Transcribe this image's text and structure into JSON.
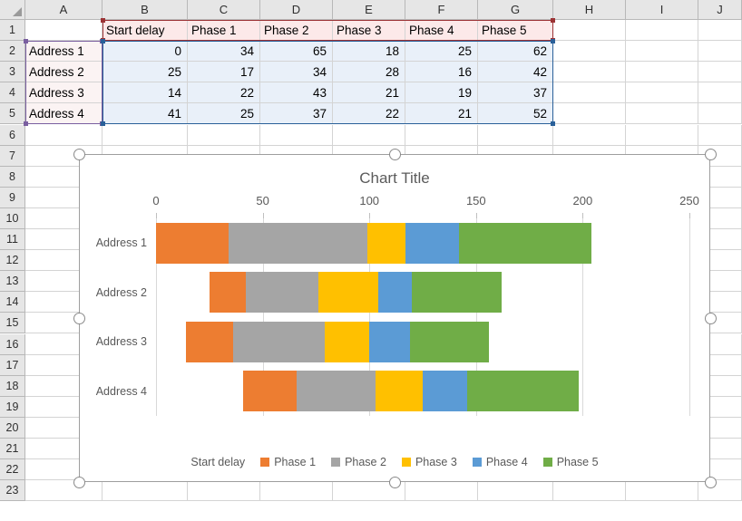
{
  "spreadsheet": {
    "columns": [
      "A",
      "B",
      "C",
      "D",
      "E",
      "F",
      "G",
      "H",
      "I",
      "J"
    ],
    "rows": [
      "1",
      "2",
      "3",
      "4",
      "5",
      "6",
      "7",
      "8",
      "9",
      "10",
      "11",
      "12",
      "13",
      "14",
      "15",
      "16",
      "17",
      "18",
      "19",
      "20",
      "21",
      "22",
      "23"
    ],
    "header_row": [
      "",
      "Start delay",
      "Phase 1",
      "Phase 2",
      "Phase 3",
      "Phase 4",
      "Phase 5"
    ],
    "data_rows": [
      {
        "label": "Address 1",
        "values": [
          "0",
          "34",
          "65",
          "18",
          "25",
          "62"
        ]
      },
      {
        "label": "Address 2",
        "values": [
          "25",
          "17",
          "34",
          "28",
          "16",
          "42"
        ]
      },
      {
        "label": "Address 3",
        "values": [
          "14",
          "22",
          "43",
          "21",
          "19",
          "37"
        ]
      },
      {
        "label": "Address 4",
        "values": [
          "41",
          "25",
          "37",
          "22",
          "21",
          "52"
        ]
      }
    ],
    "selection": {
      "header_border_color": "#9c3335",
      "label_border_color": "#7a5fa0",
      "data_border_color": "#2a6099"
    }
  },
  "chart": {
    "title": "Chart Title",
    "selected": true
  },
  "chart_data": {
    "type": "bar",
    "orientation": "horizontal",
    "stacked": true,
    "title": "Chart Title",
    "xlabel": "",
    "ylabel": "",
    "categories": [
      "Address 1",
      "Address 2",
      "Address 3",
      "Address 4"
    ],
    "xlim": [
      0,
      250
    ],
    "xticks": [
      0,
      50,
      100,
      150,
      200,
      250
    ],
    "grid": true,
    "legend_position": "bottom",
    "series": [
      {
        "name": "Start delay",
        "color": "#ffffff",
        "visible": false,
        "values": [
          0,
          25,
          14,
          41
        ]
      },
      {
        "name": "Phase 1",
        "color": "#ED7D31",
        "visible": true,
        "values": [
          34,
          17,
          22,
          25
        ]
      },
      {
        "name": "Phase 2",
        "color": "#A5A5A5",
        "visible": true,
        "values": [
          65,
          34,
          43,
          37
        ]
      },
      {
        "name": "Phase 3",
        "color": "#FFC000",
        "visible": true,
        "values": [
          18,
          28,
          21,
          22
        ]
      },
      {
        "name": "Phase 4",
        "color": "#5B9BD5",
        "visible": true,
        "values": [
          25,
          16,
          19,
          21
        ]
      },
      {
        "name": "Phase 5",
        "color": "#70AD47",
        "visible": true,
        "values": [
          62,
          42,
          37,
          52
        ]
      }
    ]
  }
}
